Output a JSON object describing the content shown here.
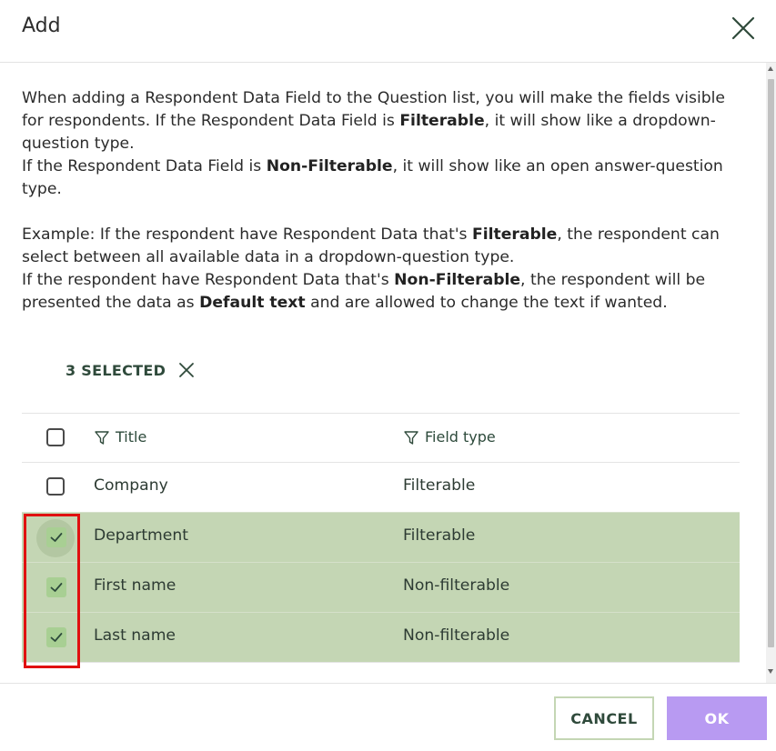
{
  "dialog": {
    "title": "Add",
    "close_icon": "close-icon"
  },
  "description": {
    "p1_a": "When adding a Respondent Data Field to the Question list, you will make the fields visible for respondents. If the Respondent Data Field is ",
    "p1_b": "Filterable",
    "p1_c": ", it will show like a dropdown-question type.",
    "p2_a": "If the Respondent Data Field is ",
    "p2_b": "Non-Filterable",
    "p2_c": ", it will show like an open answer-question type.",
    "p3_a": "Example: If the respondent have Respondent Data that's ",
    "p3_b": "Filterable",
    "p3_c": ", the respondent can select between all available data in a dropdown-question type.",
    "p4_a": "If the respondent have Respondent Data that's ",
    "p4_b": "Non-Filterable",
    "p4_c": ", the respondent will be presented the data as ",
    "p4_d": "Default text",
    "p4_e": " and are allowed to change the text if wanted."
  },
  "selection": {
    "label": "3 SELECTED",
    "clear_icon": "close-icon"
  },
  "table": {
    "headers": {
      "title": "Title",
      "field_type": "Field type",
      "filter_icon": "filter-icon"
    },
    "rows": [
      {
        "title": "Company",
        "field_type": "Filterable",
        "checked": false
      },
      {
        "title": "Department",
        "field_type": "Filterable",
        "checked": true
      },
      {
        "title": "First name",
        "field_type": "Non-filterable",
        "checked": true
      },
      {
        "title": "Last name",
        "field_type": "Non-filterable",
        "checked": true
      }
    ]
  },
  "footer": {
    "cancel_label": "CANCEL",
    "ok_label": "OK"
  },
  "colors": {
    "selected_row": "#c4d6b4",
    "checkbox_checked": "#a8cf93",
    "ok_button": "#b89af2",
    "highlight": "#e01010",
    "accent_text": "#2f4a3b"
  }
}
